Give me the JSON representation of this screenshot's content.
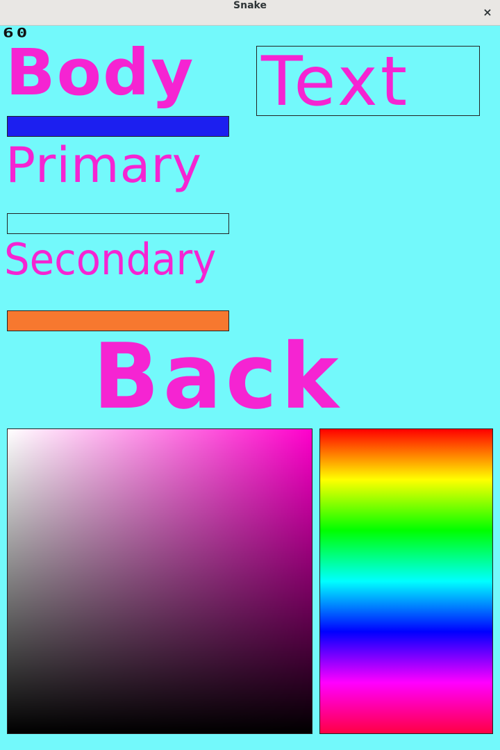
{
  "window": {
    "title": "Snake",
    "close_glyph": "×"
  },
  "fps": "60",
  "labels": {
    "body": "Body",
    "text": "Text",
    "primary": "Primary",
    "secondary": "Secondary",
    "back": "Back"
  },
  "colors": {
    "background": "#73f9fb",
    "label": "#f524d2",
    "body": "#1c1ff0",
    "primary": "#73f9fb",
    "secondary": "#f7782f",
    "picker_hue": "#ff00cc"
  }
}
